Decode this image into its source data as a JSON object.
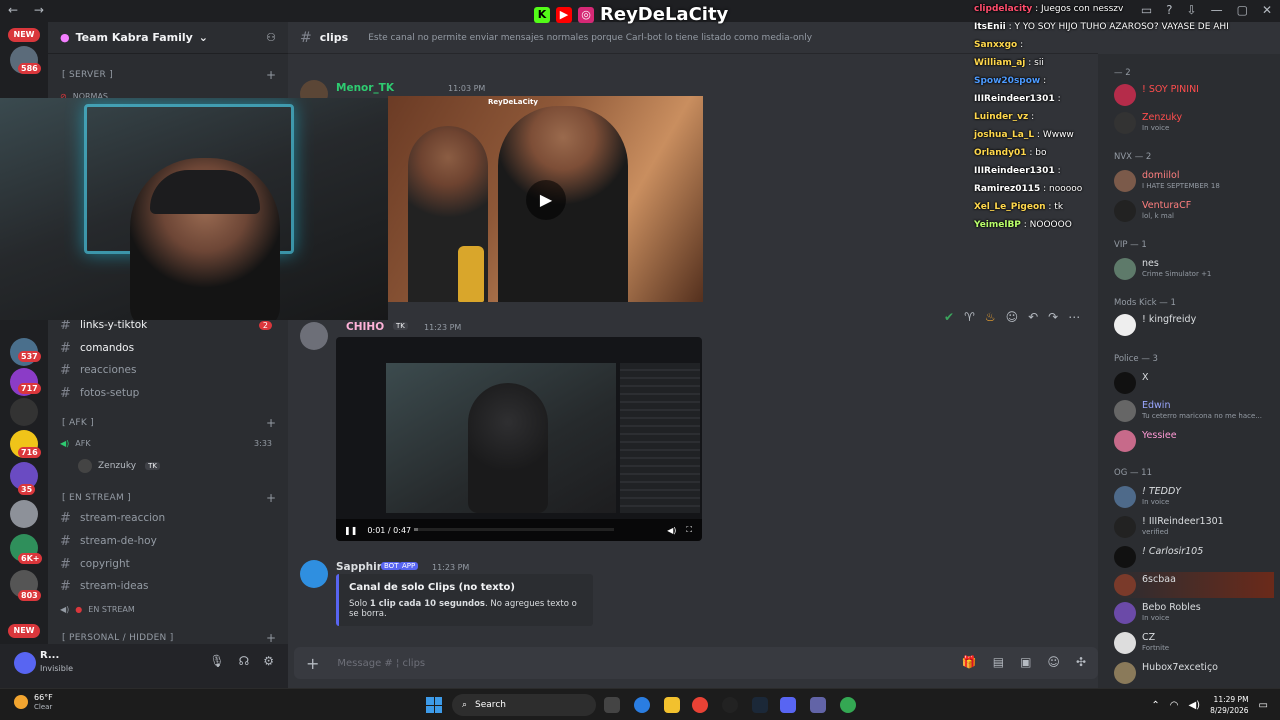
{
  "brand": {
    "name": "ReyDeLaCity"
  },
  "overlay_chat": [
    {
      "user": "clipdelacity",
      "text": "Juegos con nesszv",
      "color": "#ff4d6d"
    },
    {
      "user": "ItsEnii",
      "text": "Y YO SOY HIJO TUHO AZAROSO? VAYASE DE AHI",
      "color": "#ffffff"
    },
    {
      "user": "Sanxxgo",
      "text": "",
      "color": "#ffd84d"
    },
    {
      "user": "William_aj",
      "text": "sii",
      "color": "#ffd84d"
    },
    {
      "user": "Spow20spow",
      "text": "",
      "color": "#4d9bff"
    },
    {
      "user": "IIIReindeer1301",
      "text": "",
      "color": "#ffffff"
    },
    {
      "user": "Luinder_vz",
      "text": "",
      "color": "#ffd84d"
    },
    {
      "user": "joshua_La_L",
      "text": "Wwww",
      "color": "#ffd84d"
    },
    {
      "user": "Orlandy01",
      "text": "bo",
      "color": "#ffd84d"
    },
    {
      "user": "IIIReindeer1301",
      "text": "",
      "color": "#ffffff"
    },
    {
      "user": "Ramirez0115",
      "text": "nooooo",
      "color": "#ffffff"
    },
    {
      "user": "Xel_Le_Pigeon",
      "text": "tk",
      "color": "#ffd84d"
    },
    {
      "user": "YeimelBP",
      "text": "NOOOOO",
      "color": "#b9ff6b"
    }
  ],
  "guild": {
    "name": "Team Kabra Family"
  },
  "rail": {
    "new_top": "NEW",
    "new_bottom": "NEW",
    "badges": [
      "586",
      "537",
      "717",
      "716",
      "35",
      "6K+",
      "803"
    ]
  },
  "channels": {
    "cat_server": "[ SERVER ]",
    "normas": "NORMAS",
    "links": "links-y-tiktok",
    "links_badge": "2",
    "comandos": "comandos",
    "reacciones": "reacciones",
    "fotos": "fotos-setup",
    "cat_afk": "[ AFK ]",
    "afk": "AFK",
    "afk_time": "3:33",
    "afk_user": "Zenzuky",
    "cat_stream": "[ EN STREAM ]",
    "stream_reaccion": "stream-reaccion",
    "stream_hoy": "stream-de-hoy",
    "copyright": "copyright",
    "stream_ideas": "stream-ideas",
    "en_stream": "EN STREAM",
    "cat_personal": "[ PERSONAL / HIDDEN ]"
  },
  "user_panel": {
    "name": "R...",
    "status": "Invisible"
  },
  "chat": {
    "channel": "clips",
    "topic": "Este canal no permite enviar mensajes normales porque Carl-bot lo tiene listado como media-only",
    "msg1": {
      "author": "Menor_TK",
      "time": "11:03 PM",
      "author_color": "#2ecc71"
    },
    "msg2": {
      "author": "CHIHO",
      "tag": "TK",
      "time": "11:23 PM",
      "author_color": "#ffb3d9",
      "video_time": "0:01 / 0:47",
      "progress": 0.02
    },
    "msg3": {
      "author": "Sapphire",
      "bot_tag": "BOT",
      "app_tag": "APP",
      "time": "11:23 PM",
      "embed_title": "Canal de solo Clips (no texto)",
      "embed_desc_pre": "Solo ",
      "embed_desc_bold": "1 clip cada 10 segundos",
      "embed_desc_post": ". No agregues texto o se borra."
    },
    "composer_placeholder": "Message #  ¦ clips"
  },
  "members": {
    "groups": [
      {
        "label": "— 2"
      },
      {
        "label": "NVX — 2"
      },
      {
        "label": "VIP — 1"
      },
      {
        "label": "Mods Kick — 1"
      },
      {
        "label": "Police — 3"
      },
      {
        "label": "OG — 11"
      }
    ],
    "list": [
      {
        "name": "! SOY PININI",
        "sub": "",
        "color": "#ff4d4d"
      },
      {
        "name": "Zenzuky",
        "sub": "In voice",
        "color": "#ff4d4d"
      },
      {
        "name": "domiilol",
        "sub": "I HATE SEPTEMBER 18",
        "color": "#ff7f7f"
      },
      {
        "name": "VenturaCF",
        "sub": "lol, k mal",
        "color": "#ff7f7f"
      },
      {
        "name": "nes",
        "sub": "Crime Simulator +1",
        "color": "#dbdee1"
      },
      {
        "name": "! kingfreidy",
        "sub": "",
        "color": "#ffffff"
      },
      {
        "name": "X",
        "sub": "",
        "color": "#dbdee1"
      },
      {
        "name": "Edwin",
        "sub": "Tu ceterro maricona no me hace...",
        "color": "#9aa7ff"
      },
      {
        "name": "Yessiee",
        "sub": "",
        "color": "#ff9ad5"
      },
      {
        "name": "! TEDDY",
        "sub": "In voice",
        "color": "#ffffff"
      },
      {
        "name": "! IIIReindeer1301",
        "sub": "verified",
        "color": "#ffffff"
      },
      {
        "name": "! Carlosir105",
        "sub": "",
        "color": "#ffffff"
      },
      {
        "name": "6scbaa",
        "sub": "",
        "color": "#ffffff"
      },
      {
        "name": "Bebo Robles",
        "sub": "In voice",
        "color": "#ffffff"
      },
      {
        "name": "CZ",
        "sub": "Fortnite",
        "color": "#ffffff"
      },
      {
        "name": "Hubox7excetiço",
        "sub": "",
        "color": "#ffffff"
      }
    ]
  },
  "taskbar": {
    "temp": "66°F",
    "condition": "Clear",
    "search": "Search",
    "time": "11:29 PM",
    "date": "8/29/2026"
  }
}
